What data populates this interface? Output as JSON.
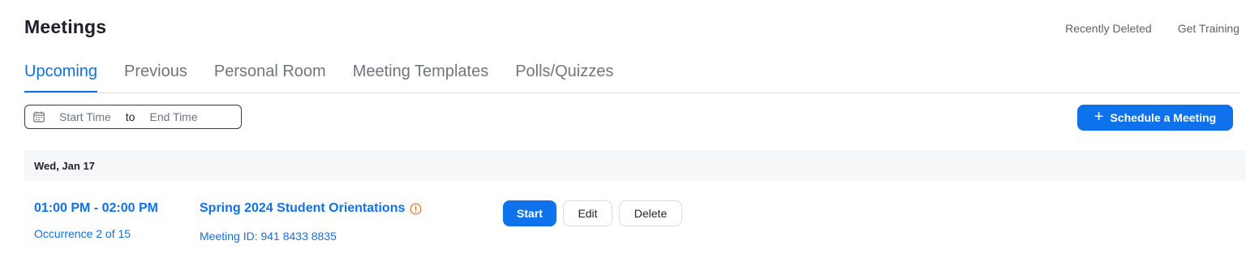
{
  "header": {
    "title": "Meetings",
    "links": {
      "recently_deleted": "Recently Deleted",
      "get_training": "Get Training"
    }
  },
  "tabs": [
    {
      "label": "Upcoming",
      "active": true
    },
    {
      "label": "Previous"
    },
    {
      "label": "Personal Room"
    },
    {
      "label": "Meeting Templates"
    },
    {
      "label": "Polls/Quizzes"
    }
  ],
  "filter": {
    "start_placeholder": "Start Time",
    "separator": "to",
    "end_placeholder": "End Time"
  },
  "schedule_button": {
    "icon": "plus-icon",
    "label": "Schedule a Meeting"
  },
  "meetings_group": {
    "date": "Wed, Jan 17",
    "meeting": {
      "time": "01:00 PM - 02:00 PM",
      "occurrence": "Occurrence 2 of 15",
      "topic": "Spring 2024 Student Orientations",
      "warning_icon": "info-alert-icon",
      "meeting_id": "Meeting ID: 941 8433 8835",
      "actions": {
        "start": "Start",
        "edit": "Edit",
        "delete": "Delete"
      }
    }
  },
  "colors": {
    "accent": "#0e72ed",
    "warning": "#e8762c",
    "header_bg": "#f6f7f9"
  }
}
